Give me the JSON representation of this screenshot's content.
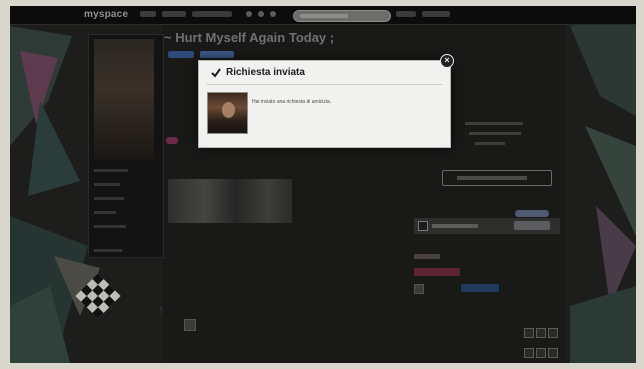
{
  "app": {
    "brand": "myspace",
    "page_title": "~ Hurt Myself Again Today ;"
  },
  "dialog": {
    "title": "Richiesta inviata",
    "message": "Hai inviato una richiesta di amicizia.",
    "close_symbol": "×"
  },
  "icons": {
    "dialog_check": "check-icon",
    "dialog_close": "close-icon"
  },
  "colors": {
    "dialog_background": "#f1f1ef",
    "page_background": "#1e1f1d",
    "accent_blue": "#2d4a7a",
    "accent_pink": "#6d2a4d"
  }
}
